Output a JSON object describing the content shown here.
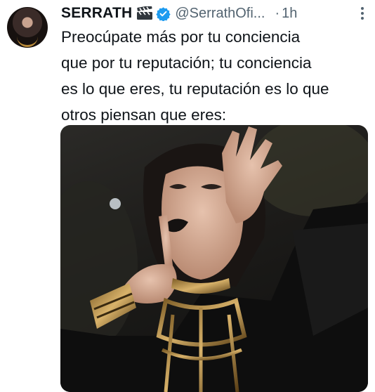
{
  "author": {
    "name": "SERRATH",
    "handle": "@SerrathOfi...",
    "dot": "·",
    "time": "1h"
  },
  "icons": {
    "avatar": "avatar",
    "clapper": "clapper-board-icon",
    "verified": "verified-badge-icon",
    "more": "more-options-icon"
  },
  "tweet": {
    "lines": [
      "Preocúpate más por tu conciencia",
      "que por tu reputación; tu conciencia",
      "es lo que eres, tu reputación es lo que",
      "otros piensan que eres:"
    ]
  },
  "colors": {
    "text": "#0f1419",
    "secondary": "#536471",
    "verified": "#1d9bf0",
    "background": "#ffffff"
  }
}
